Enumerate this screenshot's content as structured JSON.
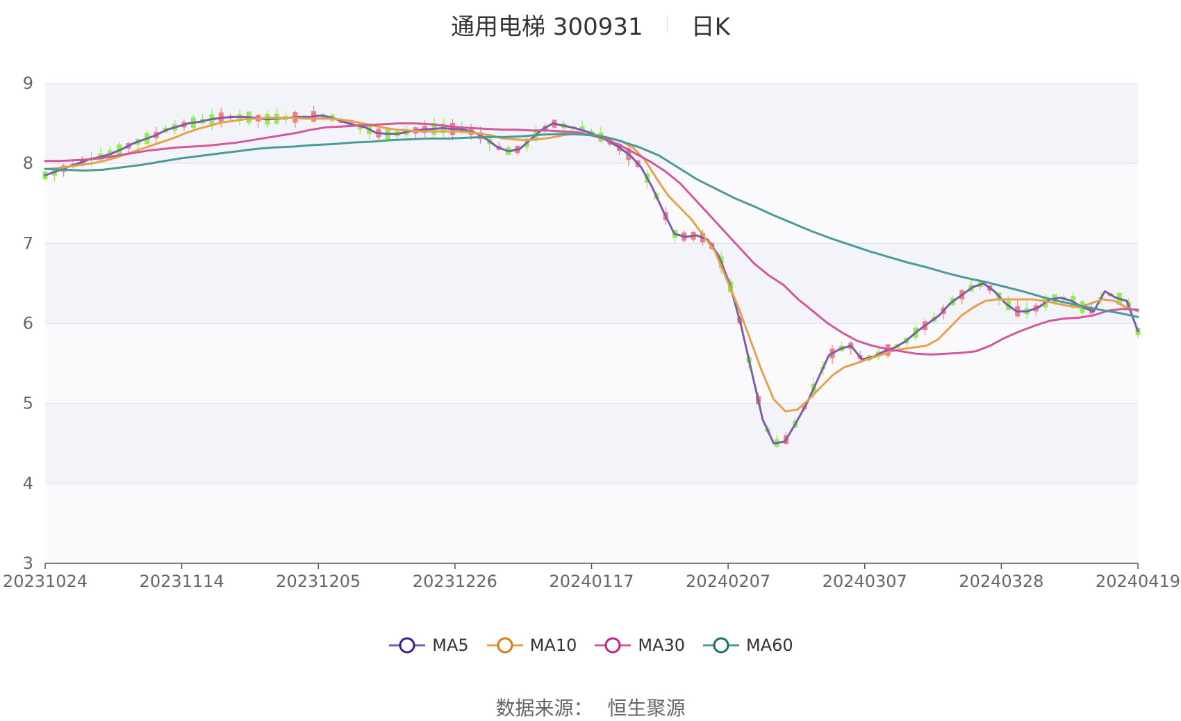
{
  "chart_data": {
    "type": "candlestick",
    "title": "通用电梯 300931",
    "subtitle": "日K",
    "ylim": [
      3,
      9
    ],
    "y_ticks": [
      "3",
      "4",
      "5",
      "6",
      "7",
      "8",
      "9"
    ],
    "x_ticks": [
      "20231024",
      "20231114",
      "20231205",
      "20231226",
      "20240117",
      "20240207",
      "20240307",
      "20240328",
      "20240419"
    ],
    "up_color": "#f08080",
    "down_color": "#90ee50",
    "series": [
      {
        "name": "MA5",
        "color": "#7b5cb0",
        "values": [
          7.85,
          7.9,
          7.95,
          8.0,
          8.05,
          8.08,
          8.12,
          8.18,
          8.25,
          8.3,
          8.35,
          8.42,
          8.46,
          8.5,
          8.52,
          8.55,
          8.57,
          8.58,
          8.58,
          8.57,
          8.55,
          8.56,
          8.57,
          8.58,
          8.58,
          8.6,
          8.57,
          8.52,
          8.48,
          8.45,
          8.38,
          8.37,
          8.37,
          8.4,
          8.42,
          8.43,
          8.44,
          8.43,
          8.42,
          8.38,
          8.3,
          8.2,
          8.15,
          8.18,
          8.3,
          8.42,
          8.5,
          8.47,
          8.44,
          8.4,
          8.35,
          8.28,
          8.2,
          8.1,
          7.95,
          7.7,
          7.4,
          7.12,
          7.08,
          7.1,
          7.05,
          6.85,
          6.5,
          6.0,
          5.4,
          4.8,
          4.5,
          4.52,
          4.75,
          5.0,
          5.3,
          5.6,
          5.68,
          5.72,
          5.55,
          5.58,
          5.65,
          5.7,
          5.78,
          5.9,
          6.0,
          6.1,
          6.25,
          6.35,
          6.45,
          6.5,
          6.4,
          6.25,
          6.15,
          6.15,
          6.2,
          6.3,
          6.32,
          6.28,
          6.2,
          6.15,
          6.4,
          6.32,
          6.28,
          5.9
        ]
      },
      {
        "name": "MA10",
        "color": "#e8a04c",
        "values": [
          7.93,
          7.94,
          7.96,
          7.98,
          8.0,
          8.03,
          8.07,
          8.12,
          8.17,
          8.22,
          8.27,
          8.32,
          8.38,
          8.43,
          8.47,
          8.51,
          8.53,
          8.55,
          8.56,
          8.57,
          8.57,
          8.57,
          8.56,
          8.56,
          8.56,
          8.55,
          8.53,
          8.5,
          8.47,
          8.44,
          8.42,
          8.41,
          8.4,
          8.4,
          8.4,
          8.4,
          8.39,
          8.37,
          8.35,
          8.31,
          8.3,
          8.29,
          8.3,
          8.32,
          8.35,
          8.37,
          8.36,
          8.35,
          8.32,
          8.28,
          8.2,
          8.05,
          7.82,
          7.6,
          7.45,
          7.3,
          7.1,
          6.9,
          6.55,
          6.2,
          5.8,
          5.4,
          5.05,
          4.9,
          4.92,
          5.05,
          5.2,
          5.35,
          5.45,
          5.5,
          5.55,
          5.6,
          5.65,
          5.68,
          5.7,
          5.72,
          5.8,
          5.95,
          6.1,
          6.2,
          6.28,
          6.3,
          6.3,
          6.3,
          6.3,
          6.28,
          6.25,
          6.22,
          6.2,
          6.25,
          6.3,
          6.28,
          6.2,
          6.15
        ]
      },
      {
        "name": "MA30",
        "color": "#d4569c",
        "values": [
          8.03,
          8.03,
          8.04,
          8.05,
          8.07,
          8.1,
          8.13,
          8.16,
          8.18,
          8.2,
          8.21,
          8.22,
          8.24,
          8.26,
          8.29,
          8.32,
          8.35,
          8.38,
          8.42,
          8.45,
          8.46,
          8.47,
          8.48,
          8.49,
          8.5,
          8.5,
          8.49,
          8.47,
          8.45,
          8.44,
          8.43,
          8.42,
          8.42,
          8.41,
          8.41,
          8.4,
          8.39,
          8.35,
          8.3,
          8.22,
          8.12,
          8.02,
          7.9,
          7.75,
          7.55,
          7.35,
          7.15,
          6.95,
          6.75,
          6.6,
          6.48,
          6.3,
          6.15,
          6.0,
          5.88,
          5.78,
          5.72,
          5.68,
          5.65,
          5.62,
          5.61,
          5.62,
          5.63,
          5.65,
          5.72,
          5.82,
          5.9,
          5.97,
          6.03,
          6.06,
          6.07,
          6.1,
          6.16,
          6.18,
          6.17
        ]
      },
      {
        "name": "MA60",
        "color": "#4a9a9a",
        "values": [
          7.93,
          7.92,
          7.91,
          7.92,
          7.95,
          7.98,
          8.02,
          8.06,
          8.09,
          8.12,
          8.15,
          8.18,
          8.2,
          8.21,
          8.23,
          8.24,
          8.26,
          8.27,
          8.29,
          8.3,
          8.31,
          8.31,
          8.32,
          8.33,
          8.33,
          8.34,
          8.36,
          8.37,
          8.36,
          8.34,
          8.28,
          8.2,
          8.1,
          7.95,
          7.8,
          7.68,
          7.56,
          7.46,
          7.35,
          7.25,
          7.15,
          7.06,
          6.98,
          6.9,
          6.83,
          6.76,
          6.7,
          6.63,
          6.57,
          6.52,
          6.46,
          6.4,
          6.33,
          6.27,
          6.22,
          6.17,
          6.13,
          6.08
        ]
      }
    ]
  },
  "legend": [
    {
      "label": "MA5",
      "color": "#7b5cb0",
      "ring": "#3a1e8a"
    },
    {
      "label": "MA10",
      "color": "#e8a04c",
      "ring": "#d97a1a"
    },
    {
      "label": "MA30",
      "color": "#d4569c",
      "ring": "#c0208a"
    },
    {
      "label": "MA60",
      "color": "#4a9a9a",
      "ring": "#1a6e6e"
    }
  ],
  "source": {
    "label": "数据来源：",
    "value": "恒生聚源"
  }
}
